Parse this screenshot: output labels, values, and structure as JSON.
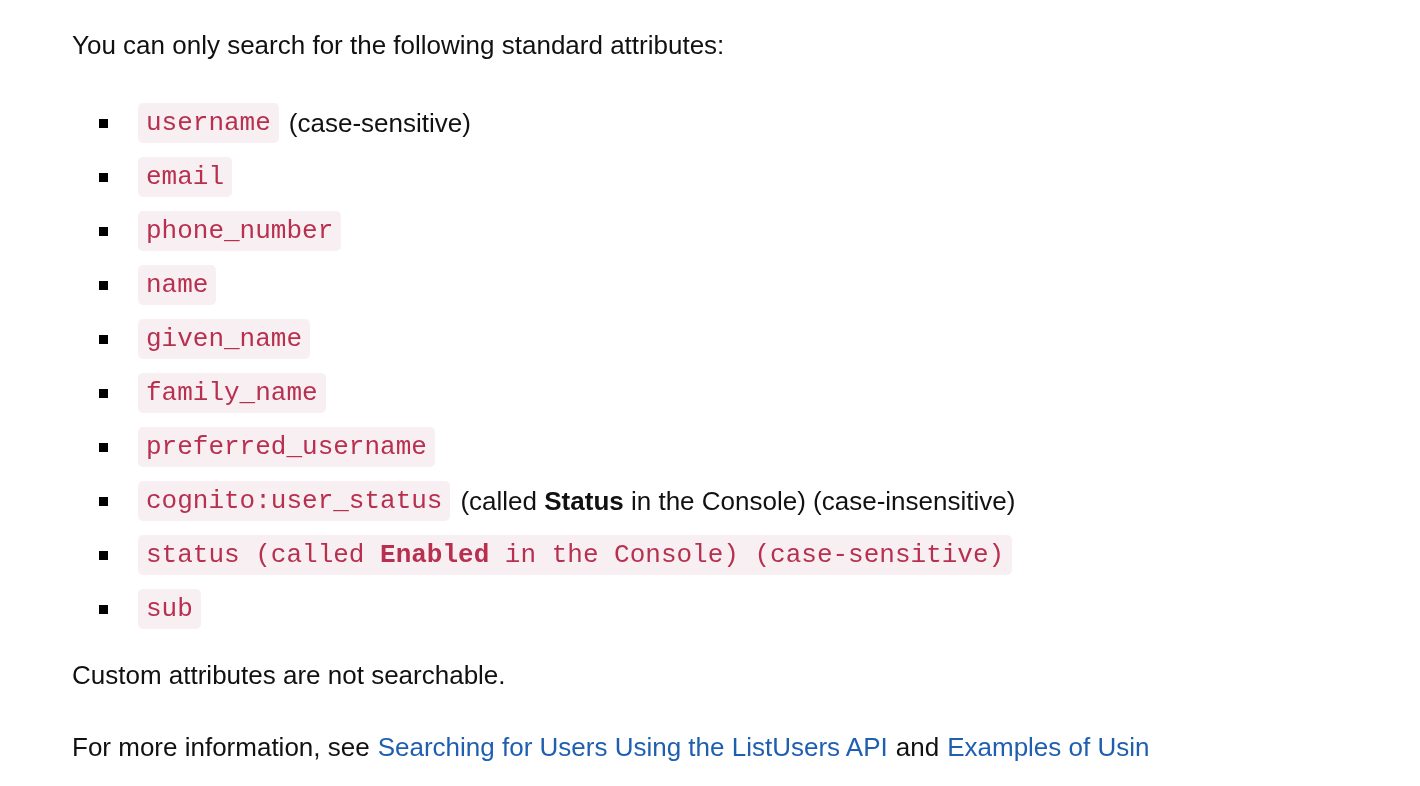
{
  "intro": "You can only search for the following standard attributes:",
  "attributes": [
    {
      "code": "username",
      "note": "(case-sensitive)"
    },
    {
      "code": "email"
    },
    {
      "code": "phone_number"
    },
    {
      "code": "name"
    },
    {
      "code": "given_name"
    },
    {
      "code": "family_name"
    },
    {
      "code": "preferred_username"
    },
    {
      "code": "cognito:user_status",
      "note": "(called **Status** in the Console) (case-insensitive)"
    },
    {
      "code": "status (called **Enabled** in the Console) (case-sensitive)"
    },
    {
      "code": "sub"
    }
  ],
  "custom_note": "Custom attributes are not searchable.",
  "more_info": [
    {
      "kind": "text",
      "text": "For more information, see"
    },
    {
      "kind": "link",
      "text": "Searching for Users Using the ListUsers API"
    },
    {
      "kind": "text",
      "text": "and"
    },
    {
      "kind": "link",
      "text": "Examples of Usin"
    }
  ]
}
